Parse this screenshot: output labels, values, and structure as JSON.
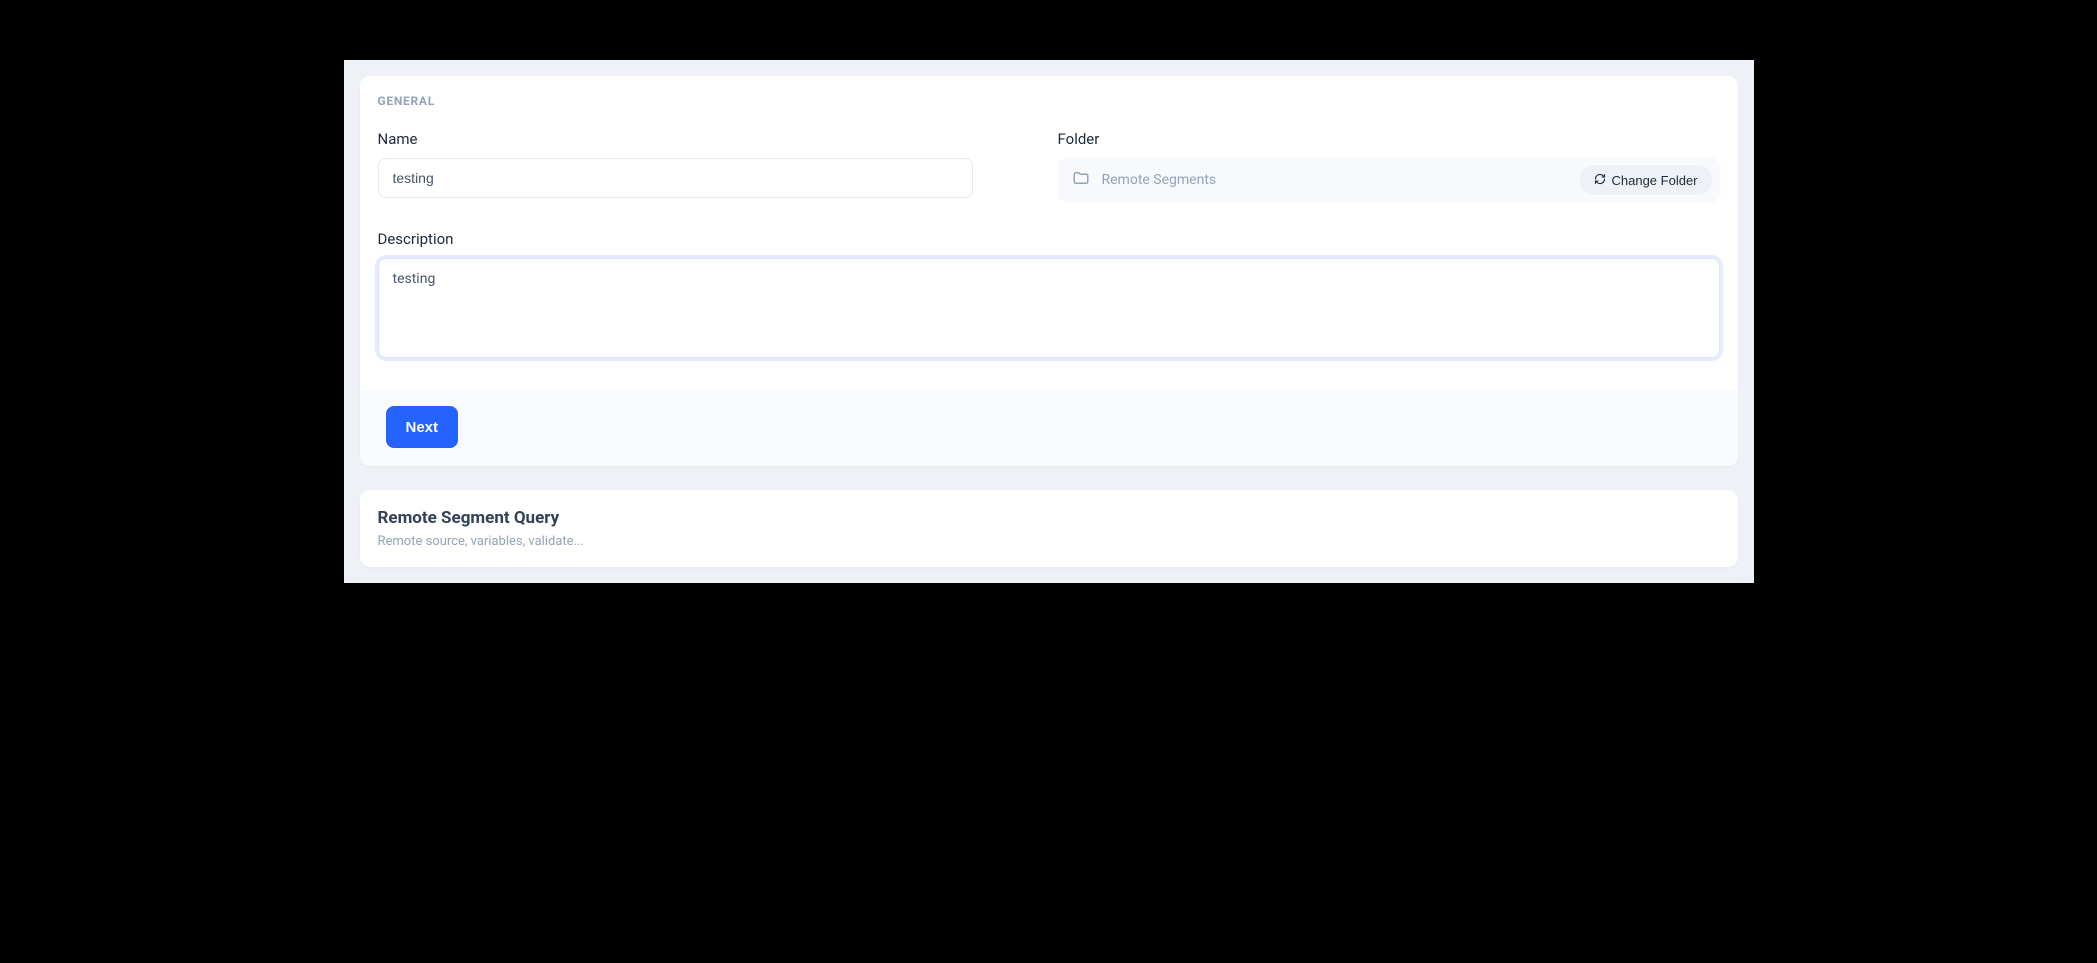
{
  "general": {
    "section_label": "GENERAL",
    "name_label": "Name",
    "name_value": "testing",
    "folder_label": "Folder",
    "folder_name": "Remote Segments",
    "change_folder_label": "Change Folder",
    "description_label": "Description",
    "description_value": "testing",
    "next_label": "Next"
  },
  "remote_query": {
    "title": "Remote Segment Query",
    "subtitle": "Remote source, variables, validate..."
  }
}
